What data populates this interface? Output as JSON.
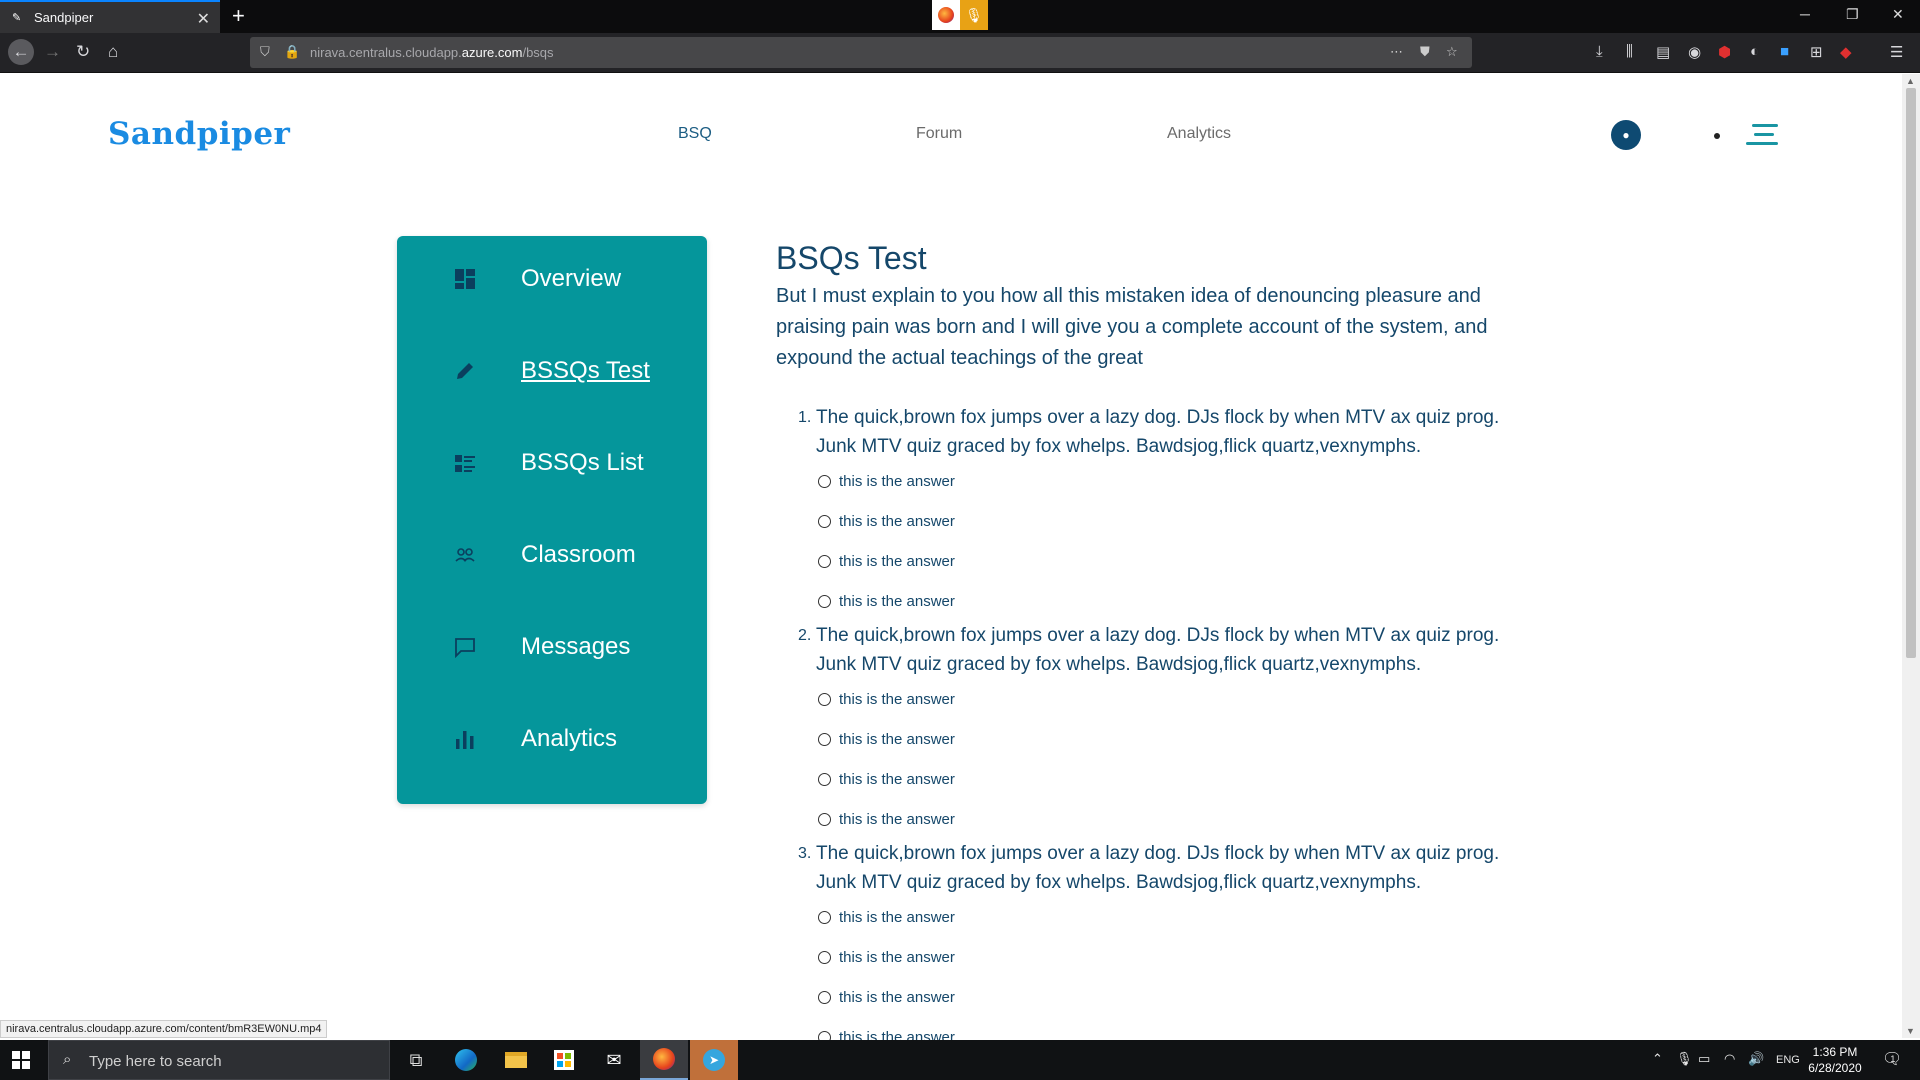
{
  "browser": {
    "tab_title": "Sandpiper",
    "url_host_prefix": "nirava.centralus.cloudapp.",
    "url_host_main": "azure.com",
    "url_path": "/bsqs",
    "status_url": "nirava.centralus.cloudapp.azure.com/content/bmR3EW0NU.mp4"
  },
  "header": {
    "brand": "Sandpiper",
    "nav": [
      "BSQ",
      "Forum",
      "Analytics"
    ],
    "active_nav": "BSQ"
  },
  "sidebar": {
    "items": [
      {
        "label": "Overview",
        "icon": "dashboard-icon"
      },
      {
        "label": "BSSQs Test",
        "icon": "pencil-icon",
        "active": true
      },
      {
        "label": "BSSQs List",
        "icon": "list-icon"
      },
      {
        "label": "Classroom",
        "icon": "people-icon"
      },
      {
        "label": "Messages",
        "icon": "chat-icon"
      },
      {
        "label": "Analytics",
        "icon": "bar-chart-icon"
      }
    ]
  },
  "main": {
    "title": "BSQs Test",
    "intro": "But I must explain to you how all this mistaken idea of denouncing pleasure and praising pain was born and I will give you a complete account of the system, and expound the actual teachings of the great",
    "questions": [
      {
        "num": "1.",
        "text": "The quick,brown fox jumps over a lazy dog. DJs flock by when MTV ax quiz prog. Junk MTV quiz graced by fox whelps. Bawdsjog,flick quartz,vexnymphs.",
        "options": [
          "this is the answer",
          "this is the answer",
          "this is the answer",
          "this is the answer"
        ]
      },
      {
        "num": "2.",
        "text": "The quick,brown fox jumps over a lazy dog. DJs flock by when MTV ax quiz prog. Junk MTV quiz graced by fox whelps. Bawdsjog,flick quartz,vexnymphs.",
        "options": [
          "this is the answer",
          "this is the answer",
          "this is the answer",
          "this is the answer"
        ]
      },
      {
        "num": "3.",
        "text": "The quick,brown fox jumps over a lazy dog. DJs flock by when MTV ax quiz prog. Junk MTV quiz graced by fox whelps. Bawdsjog,flick quartz,vexnymphs.",
        "options": [
          "this is the answer",
          "this is the answer",
          "this is the answer",
          "this is the answer"
        ]
      }
    ]
  },
  "taskbar": {
    "search_placeholder": "Type here to search",
    "language": "ENG",
    "time": "1:36 PM",
    "date": "6/28/2020",
    "notification_count": "1"
  },
  "colors": {
    "brand": "#1a8be2",
    "sidebar_bg": "#05969b",
    "text_primary": "#15476a",
    "menu_accent": "#1995a3"
  }
}
